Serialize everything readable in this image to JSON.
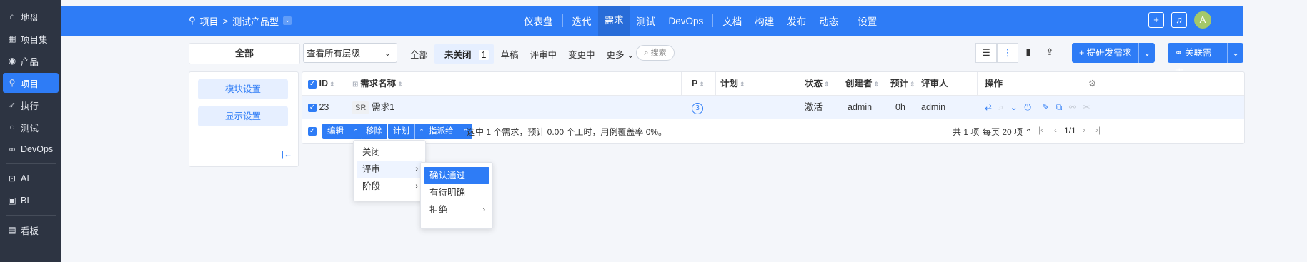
{
  "sidebar": {
    "items": [
      {
        "icon": "home-icon",
        "label": "地盘"
      },
      {
        "icon": "grid-icon",
        "label": "项目集"
      },
      {
        "icon": "location-icon",
        "label": "产品"
      },
      {
        "icon": "project-icon",
        "label": "项目",
        "active": true
      },
      {
        "icon": "rocket-icon",
        "label": "执行"
      },
      {
        "icon": "test-icon",
        "label": "测试"
      },
      {
        "icon": "infinity-icon",
        "label": "DevOps"
      },
      {
        "icon": "robot-icon",
        "label": "AI"
      },
      {
        "icon": "bi-icon",
        "label": "BI"
      },
      {
        "icon": "board-icon",
        "label": "看板"
      }
    ]
  },
  "topbar": {
    "breadcrumb": {
      "project": "项目",
      "separator": ">",
      "product": "测试产品型",
      "dropdown": "⌄"
    },
    "nav": [
      "仪表盘",
      "迭代",
      "需求",
      "测试",
      "DevOps",
      "文档",
      "构建",
      "发布",
      "动态",
      "设置"
    ],
    "active_nav": "需求",
    "right": {
      "add": "+",
      "bell": "🔔",
      "avatar": "A"
    }
  },
  "filter": {
    "all_label": "全部",
    "level_select": "查看所有层级",
    "tabs": [
      {
        "label": "全部"
      },
      {
        "label": "未关闭",
        "count": "1",
        "active": true
      },
      {
        "label": "草稿"
      },
      {
        "label": "评审中"
      },
      {
        "label": "变更中"
      },
      {
        "label": "更多 ⌄"
      }
    ],
    "search_label": "搜索"
  },
  "actions": {
    "create_req": "+ 提研发需求",
    "link_req": "关联需求"
  },
  "left_panel": {
    "module_btn": "模块设置",
    "display_btn": "显示设置",
    "collapse": "|←"
  },
  "table": {
    "headers": {
      "id": "ID",
      "name": "需求名称",
      "p": "P",
      "plan": "计划",
      "status": "状态",
      "creator": "创建者",
      "estimate": "预计",
      "reviewer": "评审人",
      "ops": "操作"
    },
    "rows": [
      {
        "id": "23",
        "type": "SR",
        "name": "需求1",
        "p": "3",
        "plan": "",
        "status": "激活",
        "creator": "admin",
        "estimate": "0h",
        "reviewer": "admin"
      }
    ]
  },
  "footer": {
    "batch_buttons": [
      "编辑",
      "移除",
      "计划",
      "指派给"
    ],
    "summary": "选中 1 个需求，预计 0.00 个工时，用例覆盖率 0%。",
    "total": "共 1 项",
    "per_page": "每页 20 项 ⌃",
    "page": "1/1"
  },
  "menu1": {
    "items": [
      "关闭",
      "评审",
      "阶段"
    ]
  },
  "menu2": {
    "items": [
      "确认通过",
      "有待明确",
      "拒绝"
    ]
  },
  "colors": {
    "primary": "#2e7cf6",
    "sidebar": "#2d3442"
  }
}
